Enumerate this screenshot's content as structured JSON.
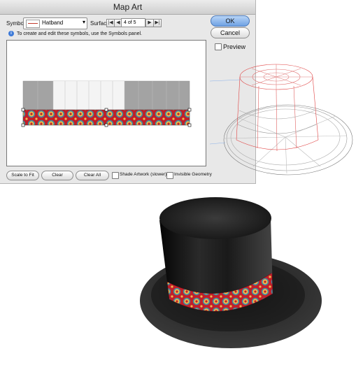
{
  "dialog": {
    "title": "Map Art",
    "symbol_label": "Symbol:",
    "symbol_value": "Hatband",
    "surface_label": "Surface:",
    "surface_value": "4 of 5",
    "info_text": "To create and edit these symbols, use the Symbols panel.",
    "ok_label": "OK",
    "cancel_label": "Cancel",
    "preview_label": "Preview",
    "preview_checked": false,
    "scale_to_fit_label": "Scale to Fit",
    "clear_label": "Clear",
    "clear_all_label": "Clear All",
    "shade_artwork_label": "Shade Artwork (slower)",
    "shade_artwork_checked": false,
    "invisible_geometry_label": "Invisible Geometry",
    "invisible_geometry_checked": false
  },
  "colors": {
    "band_red": "#c0202a",
    "band_medallion": "#f2b84a",
    "band_teal": "#3a8fa8",
    "hat_black": "#151515",
    "wire_red": "#e04040",
    "wire_gray": "#8a8a8a"
  },
  "icons": {
    "first": "first-surface-icon",
    "prev": "prev-surface-icon",
    "next": "next-surface-icon",
    "last": "last-surface-icon",
    "info": "info-icon"
  }
}
